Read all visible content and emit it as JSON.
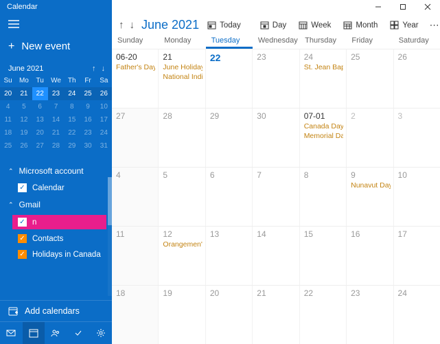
{
  "app_title": "Calendar",
  "sidebar": {
    "new_event": "New event",
    "mini_month_label": "June 2021",
    "mini_dow": [
      "Su",
      "Mo",
      "Tu",
      "We",
      "Th",
      "Fr",
      "Sa"
    ],
    "mini_weeks": [
      [
        {
          "n": "20",
          "cls": "currow"
        },
        {
          "n": "21",
          "cls": "currow"
        },
        {
          "n": "22",
          "cls": "today"
        },
        {
          "n": "23",
          "cls": "currow"
        },
        {
          "n": "24",
          "cls": "currow"
        },
        {
          "n": "25",
          "cls": "currow"
        },
        {
          "n": "26",
          "cls": "currow"
        }
      ],
      [
        {
          "n": "4",
          "cls": "dim"
        },
        {
          "n": "5",
          "cls": "dim"
        },
        {
          "n": "6",
          "cls": "dim"
        },
        {
          "n": "7",
          "cls": "dim"
        },
        {
          "n": "8",
          "cls": "dim"
        },
        {
          "n": "9",
          "cls": "dim"
        },
        {
          "n": "10",
          "cls": "dim"
        }
      ],
      [
        {
          "n": "11",
          "cls": "dim"
        },
        {
          "n": "12",
          "cls": "dim"
        },
        {
          "n": "13",
          "cls": "dim"
        },
        {
          "n": "14",
          "cls": "dim"
        },
        {
          "n": "15",
          "cls": "dim"
        },
        {
          "n": "16",
          "cls": "dim"
        },
        {
          "n": "17",
          "cls": "dim"
        }
      ],
      [
        {
          "n": "18",
          "cls": "dim"
        },
        {
          "n": "19",
          "cls": "dim"
        },
        {
          "n": "20",
          "cls": "dim"
        },
        {
          "n": "21",
          "cls": "dim"
        },
        {
          "n": "22",
          "cls": "dim"
        },
        {
          "n": "23",
          "cls": "dim"
        },
        {
          "n": "24",
          "cls": "dim"
        }
      ],
      [
        {
          "n": "25",
          "cls": "dim"
        },
        {
          "n": "26",
          "cls": "dim"
        },
        {
          "n": "27",
          "cls": "dim"
        },
        {
          "n": "28",
          "cls": "dim"
        },
        {
          "n": "29",
          "cls": "dim"
        },
        {
          "n": "30",
          "cls": "dim"
        },
        {
          "n": "31",
          "cls": "dim"
        }
      ]
    ],
    "accounts": [
      {
        "name": "Microsoft account",
        "calendars": [
          {
            "label": "Calendar",
            "style": "blue"
          }
        ]
      },
      {
        "name": "Gmail",
        "calendars": [
          {
            "label": "n",
            "style": "pink"
          },
          {
            "label": "Contacts",
            "style": "orange"
          },
          {
            "label": "Holidays in Canada",
            "style": "orange"
          }
        ]
      }
    ],
    "add_calendars": "Add calendars"
  },
  "toolbar": {
    "month_title": "June 2021",
    "today": "Today",
    "day": "Day",
    "week": "Week",
    "month": "Month",
    "year": "Year"
  },
  "dow": [
    "Sunday",
    "Monday",
    "Tuesday",
    "Wednesday",
    "Thursday",
    "Friday",
    "Saturday"
  ],
  "today_col_index": 2,
  "weeks": [
    [
      {
        "num": "06-20",
        "events": [
          "Father's Day"
        ],
        "strong": true
      },
      {
        "num": "21",
        "events": [
          "June Holiday (N",
          "National Indige"
        ],
        "strong": true
      },
      {
        "num": "22",
        "events": [],
        "today": true
      },
      {
        "num": "23",
        "events": []
      },
      {
        "num": "24",
        "events": [
          "St. Jean Baptist"
        ]
      },
      {
        "num": "25",
        "events": []
      },
      {
        "num": "26",
        "events": []
      }
    ],
    [
      {
        "num": "27",
        "events": []
      },
      {
        "num": "28",
        "events": []
      },
      {
        "num": "29",
        "events": []
      },
      {
        "num": "30",
        "events": []
      },
      {
        "num": "07-01",
        "events": [
          "Canada Day",
          "Memorial Day ("
        ],
        "strong": true
      },
      {
        "num": "2",
        "events": [],
        "next": true
      },
      {
        "num": "3",
        "events": [],
        "next": true
      }
    ],
    [
      {
        "num": "4",
        "events": []
      },
      {
        "num": "5",
        "events": []
      },
      {
        "num": "6",
        "events": []
      },
      {
        "num": "7",
        "events": []
      },
      {
        "num": "8",
        "events": []
      },
      {
        "num": "9",
        "events": [
          "Nunavut Day (N"
        ]
      },
      {
        "num": "10",
        "events": []
      }
    ],
    [
      {
        "num": "11",
        "events": []
      },
      {
        "num": "12",
        "events": [
          "Orangemen's D"
        ]
      },
      {
        "num": "13",
        "events": []
      },
      {
        "num": "14",
        "events": []
      },
      {
        "num": "15",
        "events": []
      },
      {
        "num": "16",
        "events": []
      },
      {
        "num": "17",
        "events": []
      }
    ],
    [
      {
        "num": "18",
        "events": []
      },
      {
        "num": "19",
        "events": []
      },
      {
        "num": "20",
        "events": []
      },
      {
        "num": "21",
        "events": []
      },
      {
        "num": "22",
        "events": []
      },
      {
        "num": "23",
        "events": []
      },
      {
        "num": "24",
        "events": []
      }
    ]
  ]
}
